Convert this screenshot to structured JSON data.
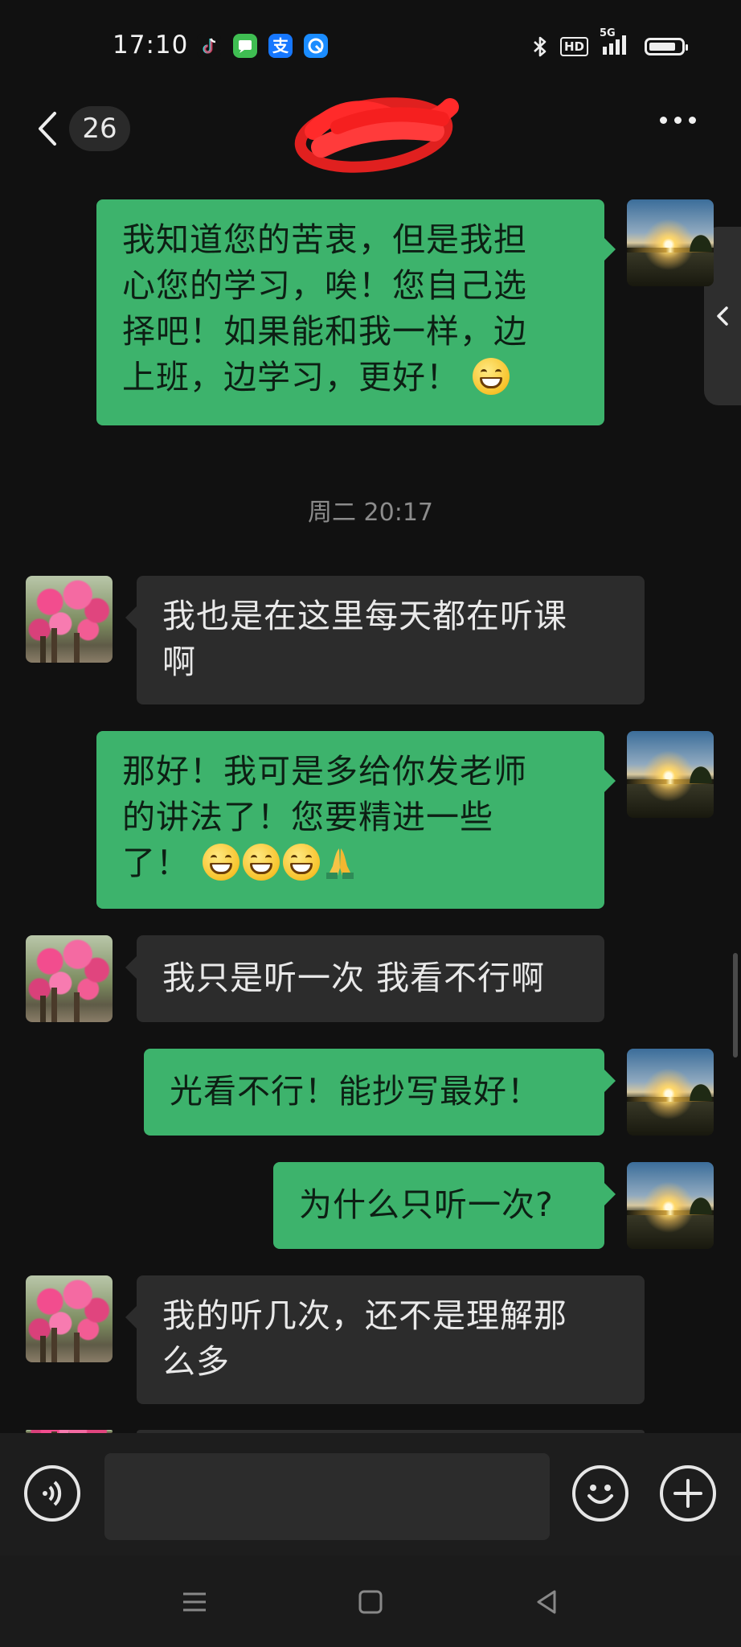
{
  "status_bar": {
    "time": "17:10",
    "apps": [
      "tiktok-icon",
      "messages-icon",
      "alipay-icon",
      "browser-icon"
    ],
    "alipay_glyph": "支",
    "hd_label": "HD",
    "network_label": "5G",
    "battery_percent": 85
  },
  "nav": {
    "unread_count": "26",
    "title_redacted": true
  },
  "messages": [
    {
      "side": "me",
      "text": "我知道您的苦衷，但是我担心您的学习，唉！您自己选择吧！如果能和我一样，边上班，边学习，更好！",
      "emojis": [
        "grin-emoji"
      ]
    },
    {
      "side": "time",
      "text": "周二 20:17"
    },
    {
      "side": "other",
      "text": "我也是在这里每天都在听课啊"
    },
    {
      "side": "me",
      "text": "那好！我可是多给你发老师的讲法了！您要精进一些了！",
      "emojis": [
        "grin-emoji",
        "grin-emoji",
        "grin-emoji",
        "pray-emoji"
      ]
    },
    {
      "side": "other",
      "text": "我只是听一次 我看不行啊"
    },
    {
      "side": "me",
      "text": "光看不行！能抄写最好！"
    },
    {
      "side": "me",
      "text": "为什么只听一次?"
    },
    {
      "side": "other",
      "text": "我的听几次，还不是理解那么多"
    }
  ],
  "lines": {
    "m1_l1": "我知道您的苦衷，但是我担",
    "m1_l2": "心您的学习，唉！您自己选",
    "m1_l3": "择吧！如果能和我一样，边",
    "m1_l4": "上班，边学习，更好！",
    "m3_l1": "我也是在这里每天都在听课",
    "m3_l2": "啊",
    "m4_l1": "那好！我可是多给你发老师",
    "m4_l2": "的讲法了！您要精进一些",
    "m4_l3": "了！",
    "m8_l1": "我的听几次，还不是理解那",
    "m8_l2": "么多"
  },
  "input": {
    "placeholder": "",
    "value": ""
  },
  "colors": {
    "my_bubble": "#3db36c",
    "other_bubble": "#2c2c2c",
    "background": "#111111"
  }
}
